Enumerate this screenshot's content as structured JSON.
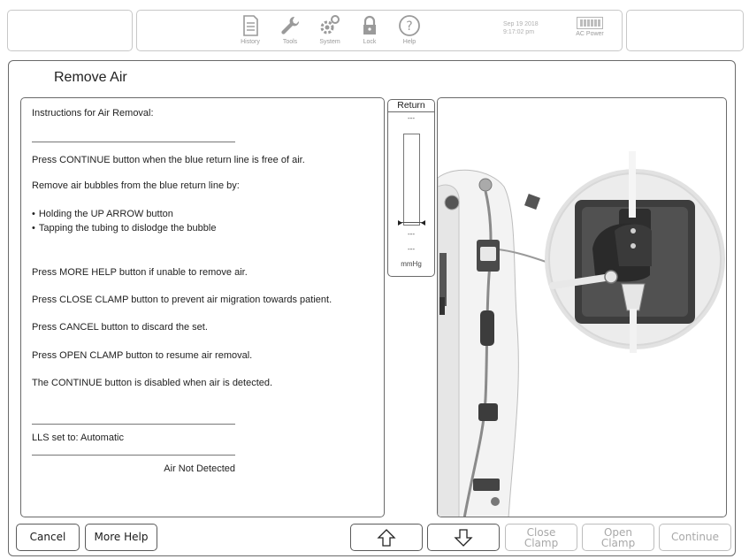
{
  "topbar": {
    "items": [
      {
        "label": "History",
        "icon": "history-icon"
      },
      {
        "label": "Tools",
        "icon": "wrench-icon"
      },
      {
        "label": "System",
        "icon": "gears-icon"
      },
      {
        "label": "Lock",
        "icon": "lock-icon"
      },
      {
        "label": "Help",
        "icon": "help-icon"
      }
    ],
    "date": "Sep 19 2018",
    "time": "9:17:02 pm",
    "power_label": "AC Power"
  },
  "screen": {
    "title": "Remove Air"
  },
  "instructions": {
    "heading": "Instructions for Air Removal:",
    "line1": "Press CONTINUE button when the  blue return line  is free of air.",
    "line2": "Remove air bubbles from the  blue return line  by:",
    "bullet1": "Holding the UP ARROW button",
    "bullet2": "Tapping the tubing to dislodge the bubble",
    "line3": "Press MORE HELP button if unable to remove air.",
    "line4": "Press CLOSE CLAMP button to prevent air migration towards patient.",
    "line5": "Press CANCEL button to discard the set.",
    "line6": "Press OPEN CLAMP button to resume air removal.",
    "line7": "The CONTINUE button is disabled when air is detected.",
    "lls": "LLS set to: Automatic",
    "air_status": "Air Not Detected"
  },
  "gauge": {
    "title": "Return",
    "top_value": "---",
    "marker_value": "---",
    "value": "---",
    "unit": "mmHg"
  },
  "buttons": {
    "cancel": "Cancel",
    "more_help": "More Help",
    "up_icon": "up-arrow-icon",
    "down_icon": "down-arrow-icon",
    "close_clamp_1": "Close",
    "close_clamp_2": "Clamp",
    "open_clamp_1": "Open",
    "open_clamp_2": "Clamp",
    "continue": "Continue"
  },
  "colors": {
    "border": "#6a6a6a",
    "disabled": "#a8a8a8",
    "machine_white": "#f2f2f2",
    "machine_dark": "#3a3a3a"
  }
}
